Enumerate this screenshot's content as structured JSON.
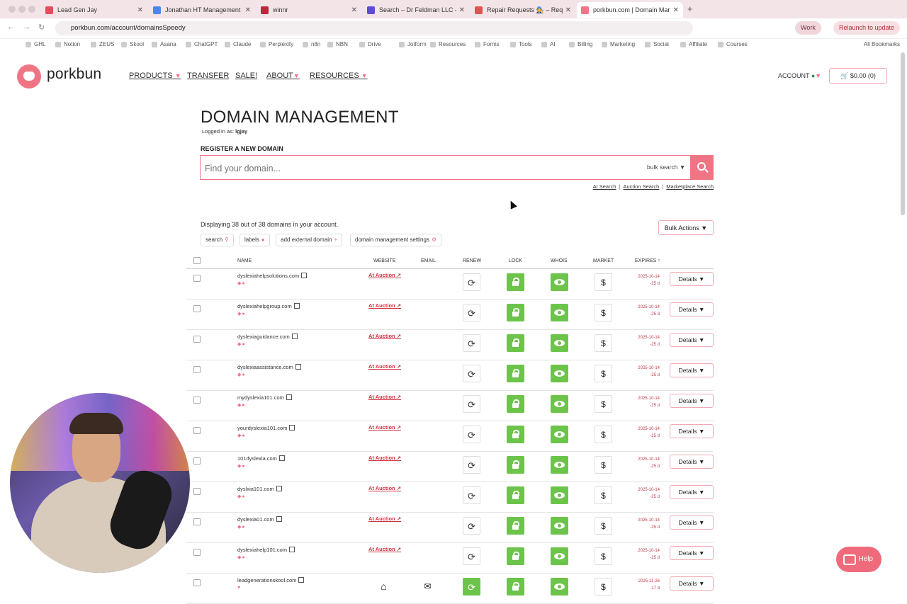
{
  "browser": {
    "tabs": [
      {
        "title": "Lead Gen Jay",
        "color": "#e44d5b"
      },
      {
        "title": "Jonathan HT Management Of",
        "color": "#4a86e8"
      },
      {
        "title": "winnr",
        "color": "#c0263a"
      },
      {
        "title": "Search – Dr Feldman LLC – S",
        "color": "#5b4bd6"
      },
      {
        "title": "Repair Requests 🧑‍🔧 – Req",
        "color": "#e05353"
      },
      {
        "title": "porkbun.com | Domain Manag",
        "color": "#ef7585"
      }
    ],
    "url": "porkbun.com/account/domainsSpeedy",
    "profile": "Work",
    "relaunch": "Relaunch to update",
    "bookmarks": [
      "GHL",
      "Notion",
      "ZEUS",
      "Skool",
      "Asana",
      "ChatGPT",
      "Claude",
      "Perplexity",
      "n8n",
      "NBN",
      "Drive",
      "Jotform",
      "Resources",
      "Forms",
      "Tools",
      "AI",
      "Billing",
      "Marketing",
      "Social",
      "Affiliate",
      "Courses"
    ],
    "all_bookmarks": "All Bookmarks"
  },
  "site": {
    "logo": "porkbun",
    "nav": [
      "PRODUCTS",
      "TRANSFER",
      "SALE!",
      "ABOUT",
      "RESOURCES"
    ],
    "account": "ACCOUNT",
    "cart": "$0.00 (0)"
  },
  "page": {
    "title": "DOMAIN MANAGEMENT",
    "logged_label": "Logged in as:",
    "logged_user": "lgjay",
    "register_heading": "REGISTER A NEW DOMAIN",
    "search_placeholder": "Find your domain...",
    "bulk_search": "bulk search",
    "links": [
      "AI Search",
      "Auction Search",
      "Marketplace Search"
    ],
    "displaying": "Displaying 38 out of 38 domains in your account.",
    "bulk_actions": "Bulk Actions",
    "tools": {
      "search": "search",
      "labels": "labels",
      "add_external": "add external domain",
      "settings": "domain management settings"
    }
  },
  "table": {
    "headers": {
      "name": "NAME",
      "website": "WEBSITE",
      "email": "EMAIL",
      "renew": "RENEW",
      "lock": "LOCK",
      "whois": "WHOIS",
      "market": "MARKET",
      "expires": "EXPIRES"
    },
    "rows": [
      {
        "domain": "dyslexiahelpsolutions.com",
        "website": "At Auction",
        "exp_date": "2025-10-14",
        "exp_days": "-25 d",
        "details": "Details"
      },
      {
        "domain": "dyslexiahelpgroup.com",
        "website": "At Auction",
        "exp_date": "2025-10-14",
        "exp_days": "-25 d",
        "details": "Details"
      },
      {
        "domain": "dyslexiaguidance.com",
        "website": "At Auction",
        "exp_date": "2025-10-14",
        "exp_days": "-25 d",
        "details": "Details"
      },
      {
        "domain": "dyslexiaassistance.com",
        "website": "At Auction",
        "exp_date": "2025-10-14",
        "exp_days": "-25 d",
        "details": "Details"
      },
      {
        "domain": "mydyslexia101.com",
        "website": "At Auction",
        "exp_date": "2025-10-14",
        "exp_days": "-25 d",
        "details": "Details"
      },
      {
        "domain": "yourdyslexia101.com",
        "website": "At Auction",
        "exp_date": "2025-10-14",
        "exp_days": "-25 d",
        "details": "Details"
      },
      {
        "domain": "101dyslexia.com",
        "website": "At Auction",
        "exp_date": "2025-10-14",
        "exp_days": "-25 d",
        "details": "Details"
      },
      {
        "domain": "dyslxia101.com",
        "website": "At Auction",
        "exp_date": "2025-10-14",
        "exp_days": "-25 d",
        "details": "Details"
      },
      {
        "domain": "dyslexia01.com",
        "website": "At Auction",
        "exp_date": "2025-10-14",
        "exp_days": "-25 d",
        "details": "Details"
      },
      {
        "domain": "dyslexiahelp101.com",
        "website": "At Auction",
        "exp_date": "2025-10-14",
        "exp_days": "-25 d",
        "details": "Details"
      },
      {
        "domain": "leadgenerationskool.com",
        "website": "",
        "exp_date": "2025-11-26",
        "exp_days": "17 d",
        "details": "Details"
      }
    ]
  },
  "help": "Help"
}
